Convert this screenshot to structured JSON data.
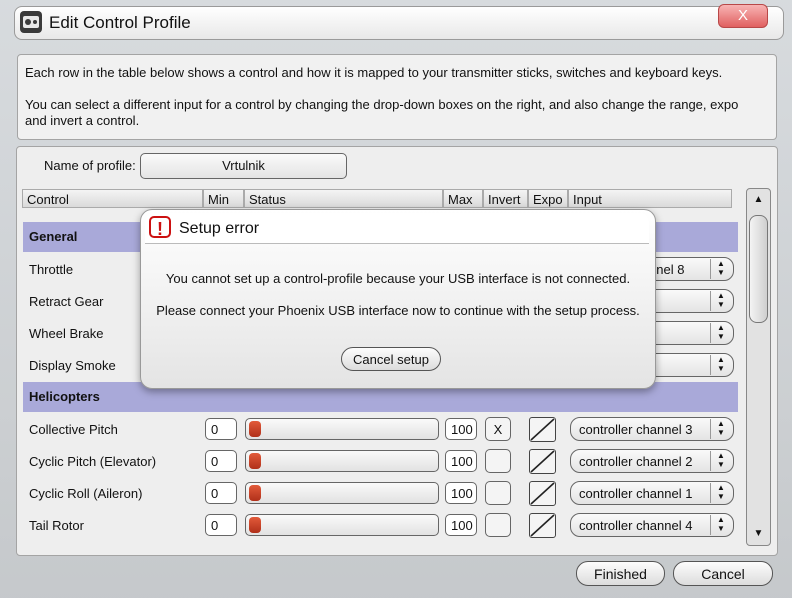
{
  "window": {
    "title": "Edit Control Profile",
    "close_label": "X"
  },
  "info": {
    "line1": "Each row in the table below shows a control and how it is mapped to your transmitter sticks, switches and keyboard keys.",
    "line2": "You can select a different input for a control by changing the drop-down boxes on the right, and also change the range, expo",
    "line3": "and invert a control."
  },
  "profile": {
    "label": "Name of profile:",
    "value": "Vrtulnik"
  },
  "table": {
    "headers": {
      "control": "Control",
      "min": "Min",
      "status": "Status",
      "max": "Max",
      "invert": "Invert",
      "expo": "Expo",
      "input": "Input"
    },
    "sections": [
      {
        "title": "General",
        "rows": [
          {
            "label": "Throttle",
            "input": "controller channel 8"
          },
          {
            "label": "Retract Gear"
          },
          {
            "label": "Wheel Brake"
          },
          {
            "label": "Display Smoke"
          }
        ]
      },
      {
        "title": "Helicopters",
        "rows": [
          {
            "label": "Collective Pitch",
            "min": "0",
            "max": "100",
            "invert": "X",
            "input": "controller channel 3"
          },
          {
            "label": "Cyclic Pitch (Elevator)",
            "min": "0",
            "max": "100",
            "invert": "",
            "input": "controller channel 2"
          },
          {
            "label": "Cyclic Roll (Aileron)",
            "min": "0",
            "max": "100",
            "invert": "",
            "input": "controller channel 1"
          },
          {
            "label": "Tail Rotor",
            "min": "0",
            "max": "100",
            "invert": "",
            "input": "controller channel 4"
          }
        ]
      }
    ],
    "throttle_input_visible": "nnel 8"
  },
  "buttons": {
    "finished": "Finished",
    "cancel": "Cancel"
  },
  "dialog": {
    "title": "Setup error",
    "warn_icon": "!",
    "msg1": "You cannot set up a control-profile because your USB interface is not connected.",
    "msg2": "Please connect your Phoenix USB interface now to continue with the setup process.",
    "cancel_label": "Cancel setup"
  },
  "colors": {
    "section_bg": "#a9a9d9",
    "knob": "#c0391f",
    "warn": "#cc1111"
  }
}
